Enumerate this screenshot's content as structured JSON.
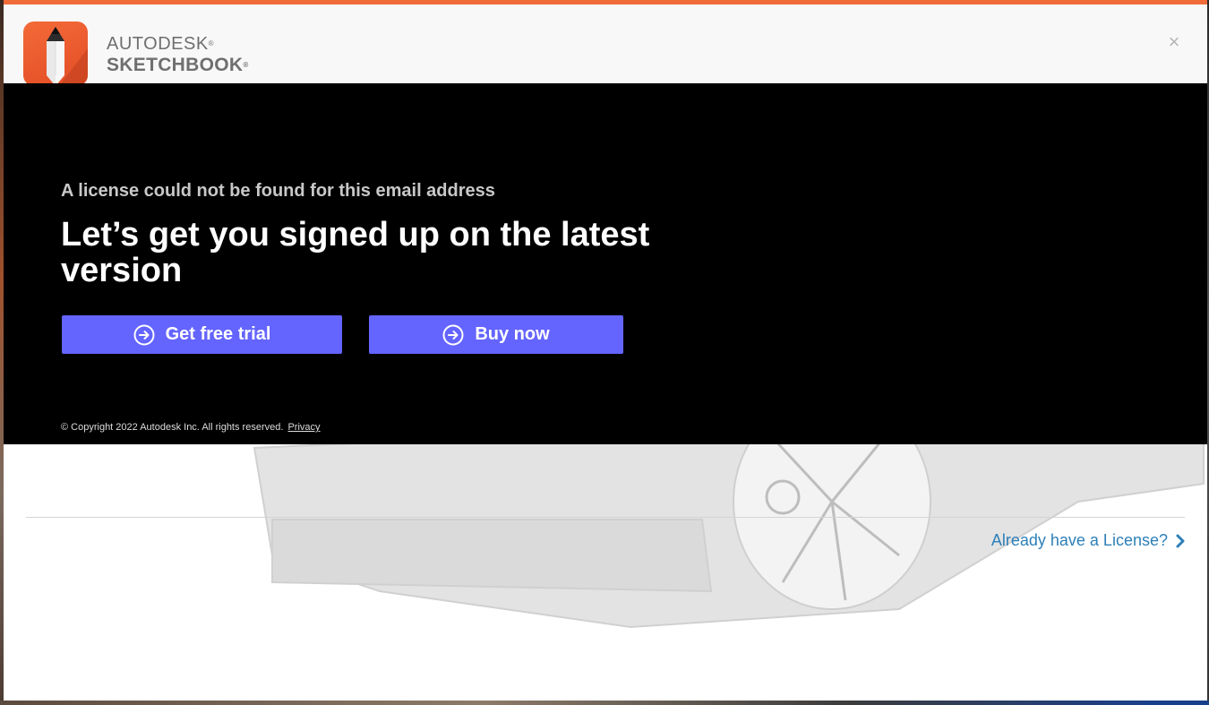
{
  "header": {
    "brand_line1": "AUTODESK",
    "brand_line2": "SKETCHBOOK",
    "registered_mark": "®",
    "close_label": "×"
  },
  "panel": {
    "subheading": "A license could not be found for this email address",
    "headline": "Let’s get you signed up on the latest version",
    "buttons": {
      "trial_label": "Get free trial",
      "buy_label": "Buy now"
    },
    "copyright": "© Copyright 2022 Autodesk Inc. All rights reserved.",
    "privacy_label": "Privacy"
  },
  "footer": {
    "license_link_label": "Already have a License?"
  },
  "colors": {
    "accent": "#f06b38",
    "button": "#6464ff",
    "link": "#2c7fb8",
    "panel_bg": "#000000"
  }
}
